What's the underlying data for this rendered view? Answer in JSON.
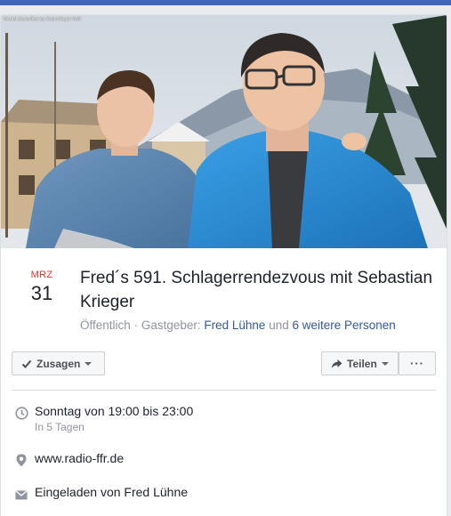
{
  "photo": {
    "credit": "©Artist Backoffice by Gabi Krieger-Wolf"
  },
  "event": {
    "month": "MRZ",
    "day": "31",
    "title": "Fred´s 591. Schlagerrendezvous mit Sebastian Krieger",
    "privacy": "Öffentlich",
    "host_prefix": "Gastgeber:",
    "host_name": "Fred Lühne",
    "and_word": "und",
    "others": "6 weitere Personen"
  },
  "actions": {
    "going_label": "Zusagen",
    "share_label": "Teilen",
    "more_label": "···"
  },
  "details": {
    "time_main": "Sonntag von 19:00 bis 23:00",
    "time_sub": "In 5 Tagen",
    "website": "www.radio-ffr.de",
    "invited_by": "Eingeladen von Fred Lühne"
  },
  "colors": {
    "accent": "#4267b2",
    "month": "#e9302a",
    "link": "#365899",
    "jacket": "#2f8fd6"
  },
  "icons": {
    "going": "check-icon",
    "share": "share-arrow-icon",
    "time": "clock-icon",
    "website": "location-pin-icon",
    "invited": "envelope-icon"
  }
}
